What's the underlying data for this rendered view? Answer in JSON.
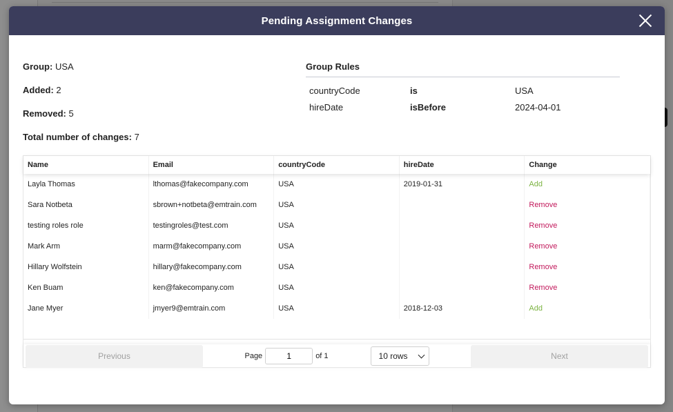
{
  "modal": {
    "title": "Pending Assignment Changes"
  },
  "summary": {
    "group_label": "Group:",
    "group_value": "USA",
    "added_label": "Added:",
    "added_value": "2",
    "removed_label": "Removed:",
    "removed_value": "5",
    "total_label": "Total number of changes:",
    "total_value": "7"
  },
  "rules": {
    "title": "Group Rules",
    "items": [
      {
        "field": "countryCode",
        "operator": "is",
        "value": "USA"
      },
      {
        "field": "hireDate",
        "operator": "isBefore",
        "value": "2024-04-01"
      }
    ]
  },
  "table": {
    "columns": [
      "Name",
      "Email",
      "countryCode",
      "hireDate",
      "Change"
    ],
    "rows": [
      {
        "name": "Layla Thomas",
        "email": "lthomas@fakecompany.com",
        "countryCode": "USA",
        "hireDate": "2019-01-31",
        "change": "Add"
      },
      {
        "name": "Sara Notbeta",
        "email": "sbrown+notbeta@emtrain.com",
        "countryCode": "USA",
        "hireDate": "",
        "change": "Remove"
      },
      {
        "name": "testing roles role",
        "email": "testingroles@test.com",
        "countryCode": "USA",
        "hireDate": "",
        "change": "Remove"
      },
      {
        "name": "Mark Arm",
        "email": "marm@fakecompany.com",
        "countryCode": "USA",
        "hireDate": "",
        "change": "Remove"
      },
      {
        "name": "Hillary Wolfstein",
        "email": "hillary@fakecompany.com",
        "countryCode": "USA",
        "hireDate": "",
        "change": "Remove"
      },
      {
        "name": "Ken Buam",
        "email": "ken@fakecompany.com",
        "countryCode": "USA",
        "hireDate": "",
        "change": "Remove"
      },
      {
        "name": "Jane Myer",
        "email": "jmyer9@emtrain.com",
        "countryCode": "USA",
        "hireDate": "2018-12-03",
        "change": "Add"
      }
    ]
  },
  "pagination": {
    "previous_label": "Previous",
    "page_label": "Page",
    "page_value": "1",
    "of_label": "of 1",
    "rows_label": "10 rows",
    "next_label": "Next"
  },
  "colors": {
    "header_bg": "#3b3d5c",
    "add": "#7cb342",
    "remove": "#c2185b"
  },
  "icons": {
    "close": "close-icon",
    "select": "chevron-down-icon"
  }
}
